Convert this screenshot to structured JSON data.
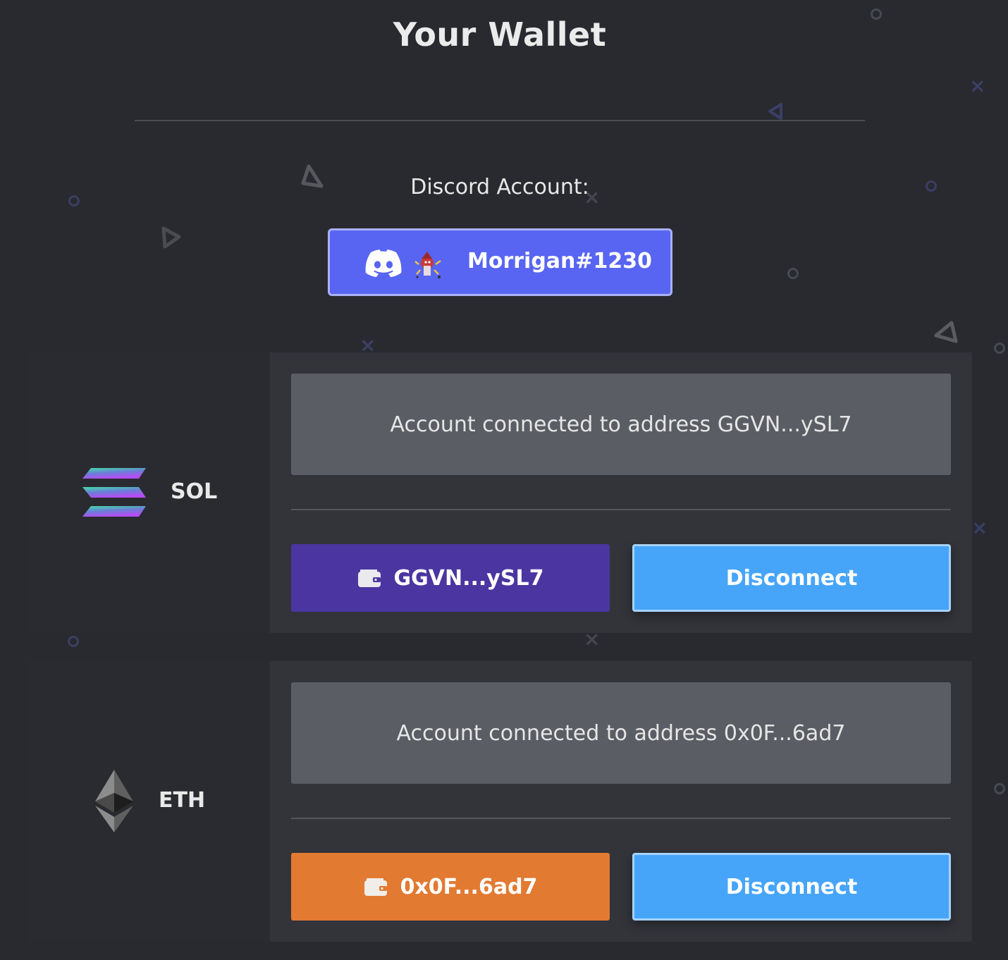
{
  "page": {
    "title": "Your Wallet"
  },
  "discord": {
    "label": "Discord Account:",
    "username": "Morrigan#1230",
    "icon": "discord-logo-icon",
    "button_color": "#5865f2"
  },
  "wallets": [
    {
      "chain": "SOL",
      "icon": "solana-logo-icon",
      "status_text": "Account connected to address GGVN...ySL7",
      "address_short": "GGVN...ySL7",
      "address_button_color": "#4b35a1",
      "disconnect_label": "Disconnect"
    },
    {
      "chain": "ETH",
      "icon": "ethereum-logo-icon",
      "status_text": "Account connected to address 0x0F...6ad7",
      "address_short": "0x0F...6ad7",
      "address_button_color": "#e27a32",
      "disconnect_label": "Disconnect"
    }
  ],
  "colors": {
    "background": "#292a2f",
    "disconnect": "#46a5f9"
  }
}
